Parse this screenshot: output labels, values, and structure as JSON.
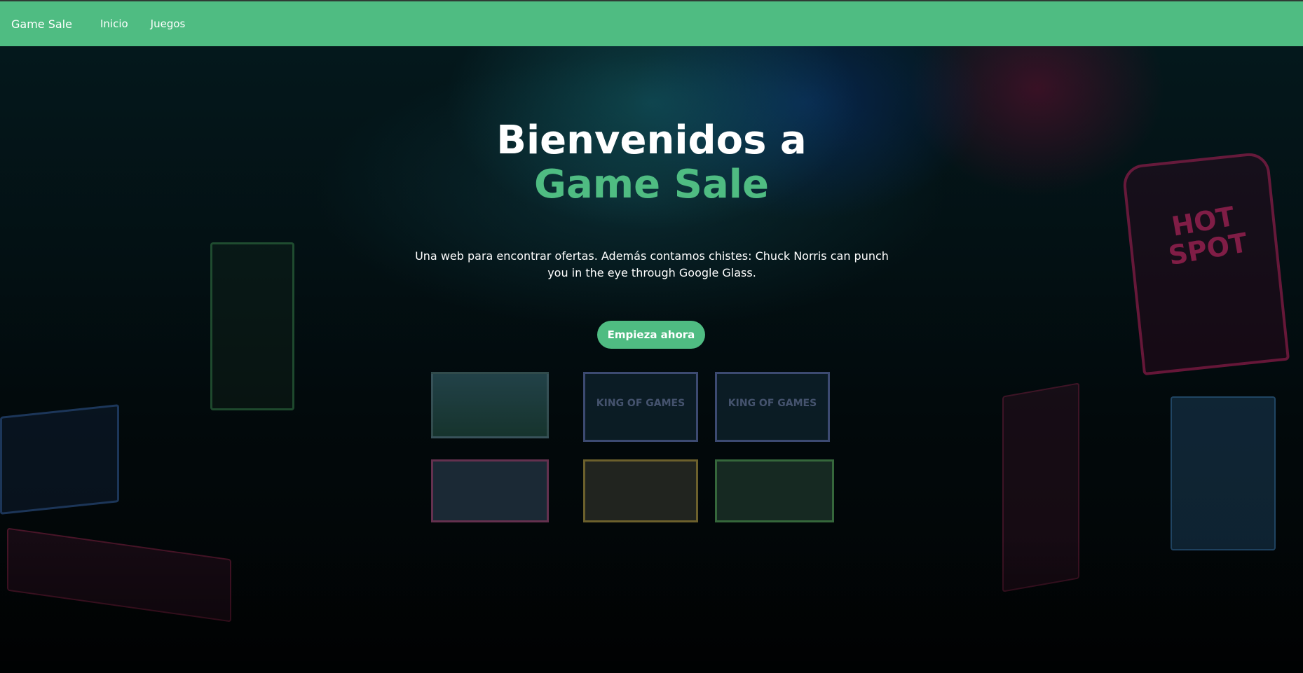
{
  "navbar": {
    "brand": "Game Sale",
    "links": [
      {
        "label": "Inicio"
      },
      {
        "label": "Juegos"
      }
    ]
  },
  "hero": {
    "title_line1": "Bienvenidos a",
    "title_line2": "Game Sale",
    "subtitle": "Una web para encontrar ofertas. Además contamos chistes: Chuck Norris can punch you in the eye through Google Glass.",
    "cta_label": "Empieza ahora",
    "background_signage": {
      "screen_text_1": "KING OF GAMES",
      "screen_text_2": "KING OF GAMES",
      "sign_text": "HOT SPOT"
    }
  },
  "colors": {
    "accent": "#4fbc82",
    "text": "#ffffff",
    "background": "#020608"
  }
}
